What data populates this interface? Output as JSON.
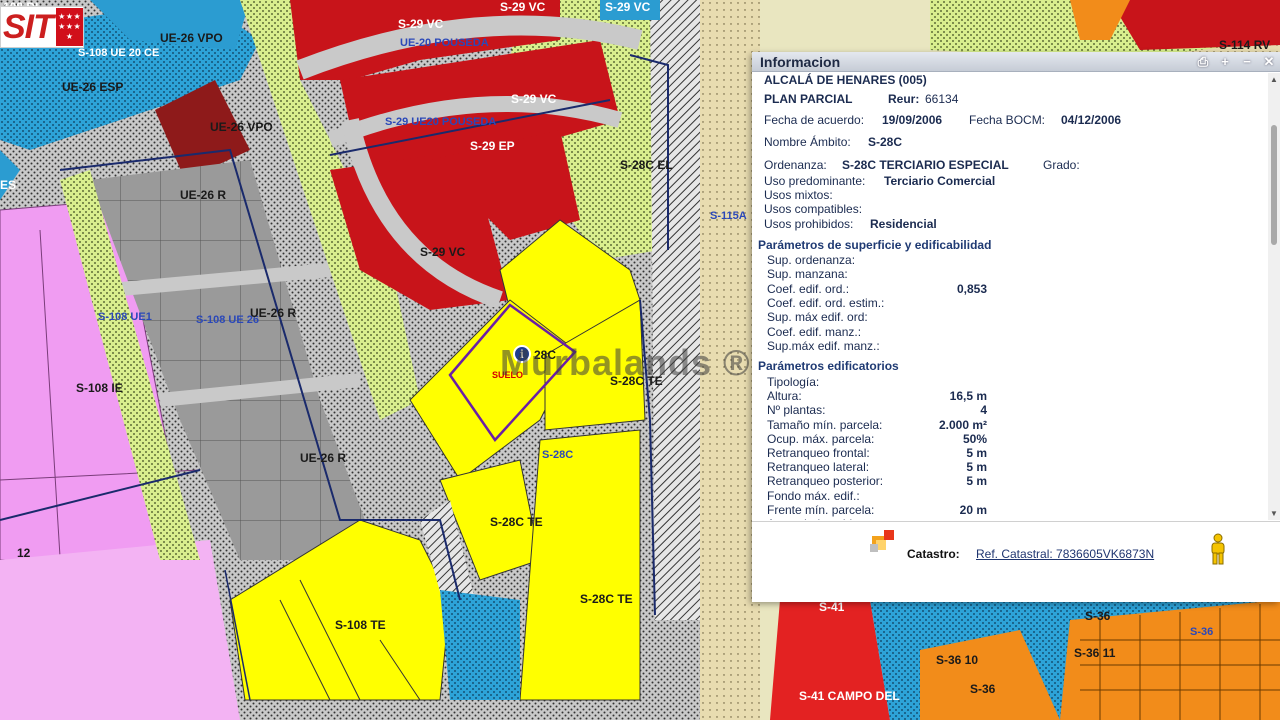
{
  "map": {
    "labels": [
      {
        "text": "108 DL",
        "cls": "white"
      },
      {
        "text": "S-108 UE 20 CE",
        "cls": "white"
      },
      {
        "text": "UE-26 VPO",
        "cls": ""
      },
      {
        "text": "UE-26 ESP",
        "cls": ""
      },
      {
        "text": "UE-26 VPO",
        "cls": ""
      },
      {
        "text": "ES",
        "cls": "white"
      },
      {
        "text": "UE-26 R",
        "cls": ""
      },
      {
        "text": "S-108 UE1",
        "cls": "blue"
      },
      {
        "text": "S-108 UE 26",
        "cls": "blue"
      },
      {
        "text": "UE-26 R",
        "cls": ""
      },
      {
        "text": "S-108 IE",
        "cls": ""
      },
      {
        "text": "UE-26 R",
        "cls": ""
      },
      {
        "text": "12",
        "cls": ""
      },
      {
        "text": "S-108 TE",
        "cls": ""
      },
      {
        "text": "S-29 VC",
        "cls": "white"
      },
      {
        "text": "S-29 VC",
        "cls": "white"
      },
      {
        "text": "UE-20 POUSEDA",
        "cls": "blue"
      },
      {
        "text": "S-29 VC",
        "cls": "white"
      },
      {
        "text": "S-29 UE20 POUSEDA",
        "cls": "blue"
      },
      {
        "text": "S-29 EP",
        "cls": "white"
      },
      {
        "text": "S-29 VC",
        "cls": ""
      },
      {
        "text": "S-28C EL",
        "cls": ""
      },
      {
        "text": "S-115A",
        "cls": "blue"
      },
      {
        "text": "S-28C TE",
        "cls": ""
      },
      {
        "text": "S-28C",
        "cls": "blue"
      },
      {
        "text": "S-28C TE",
        "cls": ""
      },
      {
        "text": "S-28C TE",
        "cls": ""
      },
      {
        "text": "S-29 VC",
        "cls": "white"
      },
      {
        "text": "S-29 VC",
        "cls": ""
      },
      {
        "text": "S-114 RV",
        "cls": ""
      },
      {
        "text": "S-41",
        "cls": "white"
      },
      {
        "text": "S-41 CAMPO DEL",
        "cls": "white"
      },
      {
        "text": "S-36",
        "cls": ""
      },
      {
        "text": "S-36 10",
        "cls": ""
      },
      {
        "text": "S-36 11",
        "cls": ""
      },
      {
        "text": "S-36",
        "cls": ""
      },
      {
        "text": "S-36",
        "cls": "blue"
      },
      {
        "text": "28C",
        "cls": ""
      },
      {
        "text": "SUELO",
        "cls": "red-marker-text"
      }
    ],
    "watermark": "Murbalands ®",
    "marker_letter": "i"
  },
  "logo": {
    "text": "SIT",
    "flag_stars": "★★★★★★★"
  },
  "info_panel": {
    "title": "Informacion",
    "municipio": "ALCALÁ DE HENARES (005)",
    "plan_label": "PLAN PARCIAL",
    "reur_label": "Reur:",
    "reur_value": "66134",
    "fecha_acuerdo_label": "Fecha de acuerdo:",
    "fecha_acuerdo_value": "19/09/2006",
    "fecha_bocm_label": "Fecha BOCM:",
    "fecha_bocm_value": "04/12/2006",
    "ambito_label": "Nombre Ámbito:",
    "ambito_value": "S-28C",
    "ordenanza_label": "Ordenanza:",
    "ordenanza_value": "S-28C TERCIARIO ESPECIAL",
    "grado_label": "Grado:",
    "uso_predominante_label": "Uso predominante:",
    "uso_predominante_value": "Terciario Comercial",
    "usos_mixtos_label": "Usos mixtos:",
    "usos_compatibles_label": "Usos compatibles:",
    "usos_prohibidos_label": "Usos prohibidos:",
    "usos_prohibidos_value": "Residencial",
    "section_superficie": "Parámetros de superficie y edificabilidad",
    "superficie": [
      {
        "label": "Sup. ordenanza:",
        "value": ""
      },
      {
        "label": "Sup. manzana:",
        "value": ""
      },
      {
        "label": "Coef. edif. ord.:",
        "value": "0,853"
      },
      {
        "label": "Coef. edif. ord. estim.:",
        "value": ""
      },
      {
        "label": "Sup. máx edif. ord:",
        "value": ""
      },
      {
        "label": "Coef. edif. manz.:",
        "value": ""
      },
      {
        "label": "Sup.máx edif. manz.:",
        "value": ""
      }
    ],
    "section_edificatorios": "Parámetros edificatorios",
    "edificatorios": [
      {
        "label": "Tipología:",
        "value": ""
      },
      {
        "label": "Altura:",
        "value": "16,5 m"
      },
      {
        "label": "Nº plantas:",
        "value": "4"
      },
      {
        "label": "Tamaño mín. parcela:",
        "value": "2.000 m²"
      },
      {
        "label": "Ocup. máx. parcela:",
        "value": "50%"
      },
      {
        "label": "Retranqueo frontal:",
        "value": "5 m"
      },
      {
        "label": "Retranqueo lateral:",
        "value": "5 m"
      },
      {
        "label": "Retranqueo posterior:",
        "value": "5 m"
      },
      {
        "label": "Fondo máx. edif.:",
        "value": ""
      },
      {
        "label": "Frente mín. parcela:",
        "value": "20 m"
      },
      {
        "label": "Aprov. bajo cubierta:",
        "value": ""
      }
    ],
    "buttons": {
      "print": "⎙",
      "maximize": "+",
      "minimize": "−",
      "close": "✕"
    },
    "catastro_label": "Catastro:",
    "catastro_link": "Ref. Catastral: 7836605VK6873N"
  }
}
